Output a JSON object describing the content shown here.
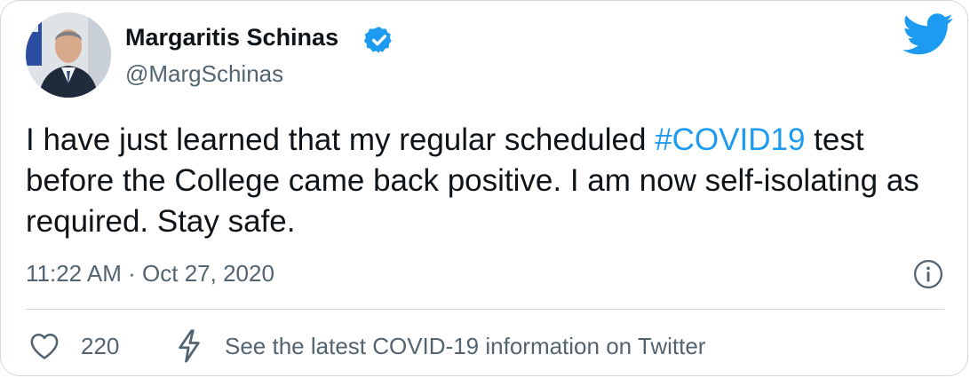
{
  "tweet": {
    "author": {
      "display_name": "Margaritis Schinas",
      "handle": "@MargSchinas",
      "verified": true
    },
    "text_parts": {
      "before": "I have just learned that my regular scheduled ",
      "hashtag": "#COVID19",
      "after": " test before the College came back positive. I am now self-isolating as required. Stay safe."
    },
    "timestamp": "11:22 AM · Oct 27, 2020",
    "like_count": "220",
    "covid_info_label": "See the latest COVID-19 information on Twitter"
  },
  "icons": {
    "brand": "twitter-bird-icon",
    "verified": "verified-badge-icon",
    "info": "info-icon",
    "like": "heart-icon",
    "covid": "lightning-icon"
  },
  "colors": {
    "accent": "#1d9bf0",
    "text": "#0f1419",
    "secondary": "#536471",
    "border": "#cfd9de"
  }
}
